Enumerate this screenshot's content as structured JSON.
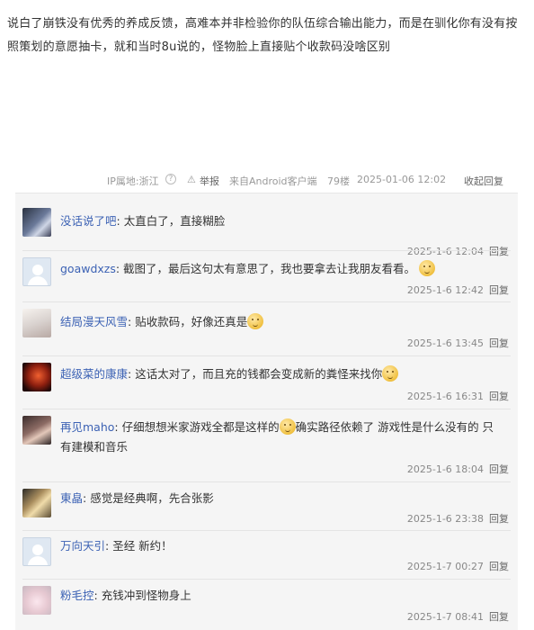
{
  "post": {
    "text": "说白了崩铁没有优秀的养成反馈，高难本并非检验你的队伍综合输出能力，而是在驯化你有没有按照策划的意愿抽卡，就和当时8u说的，怪物脸上直接贴个收款码没啥区别"
  },
  "meta": {
    "ip": "IP属地:浙江",
    "help_icon": "?",
    "warn_icon": "⚠",
    "report": "举报",
    "source": "来自Android客户端",
    "floor": "79楼",
    "datetime": "2025-01-06 12:02",
    "collapse": "收起回复"
  },
  "replies": [
    {
      "user": "没话说了吧",
      "text": ": 太直白了，直接糊脸",
      "emoji_after": false,
      "time": "2025-1-6 12:04",
      "reply_label": "回复",
      "avatar": "avatar-dark-anime"
    },
    {
      "user": "goawdxzs",
      "text": ": 截图了，最后这句太有意思了，我也要拿去让我朋友看看。",
      "emoji_after": true,
      "time": "2025-1-6 12:42",
      "reply_label": "回复",
      "avatar": "avatar-default"
    },
    {
      "user": "结局漫天风雪",
      "text": ": 贴收款码，好像还真是",
      "emoji_after": true,
      "time": "2025-1-6 13:45",
      "reply_label": "回复",
      "avatar": "avatar-white-hair"
    },
    {
      "user": "超级菜的康康",
      "text": ": 这话太对了，而且充的钱都会变成新的粪怪来找你",
      "emoji_after": true,
      "time": "2025-1-6 16:31",
      "reply_label": "回复",
      "avatar": "avatar-red-fire"
    },
    {
      "user": "再见maho",
      "text": ": 仔细想想米家游戏全都是这样的",
      "text2": "确实路径依赖了 游戏性是什么没有的 只有建模和音乐",
      "emoji_after": true,
      "time": "2025-1-6 18:04",
      "reply_label": "回复",
      "avatar": "avatar-brown-hair"
    },
    {
      "user": "東皛",
      "text": ": 感觉是经典啊，先合张影",
      "emoji_after": false,
      "time": "2025-1-6 23:38",
      "reply_label": "回复",
      "avatar": "avatar-gold"
    },
    {
      "user": "万向天引",
      "text": ": 圣经 新约！",
      "emoji_after": false,
      "time": "2025-1-7 00:27",
      "reply_label": "回复",
      "avatar": "avatar-default"
    },
    {
      "user": "粉毛控",
      "text": ": 充钱冲到怪物身上",
      "emoji_after": false,
      "time": "2025-1-7 08:41",
      "reply_label": "回复",
      "avatar": "avatar-pink-hair"
    }
  ]
}
